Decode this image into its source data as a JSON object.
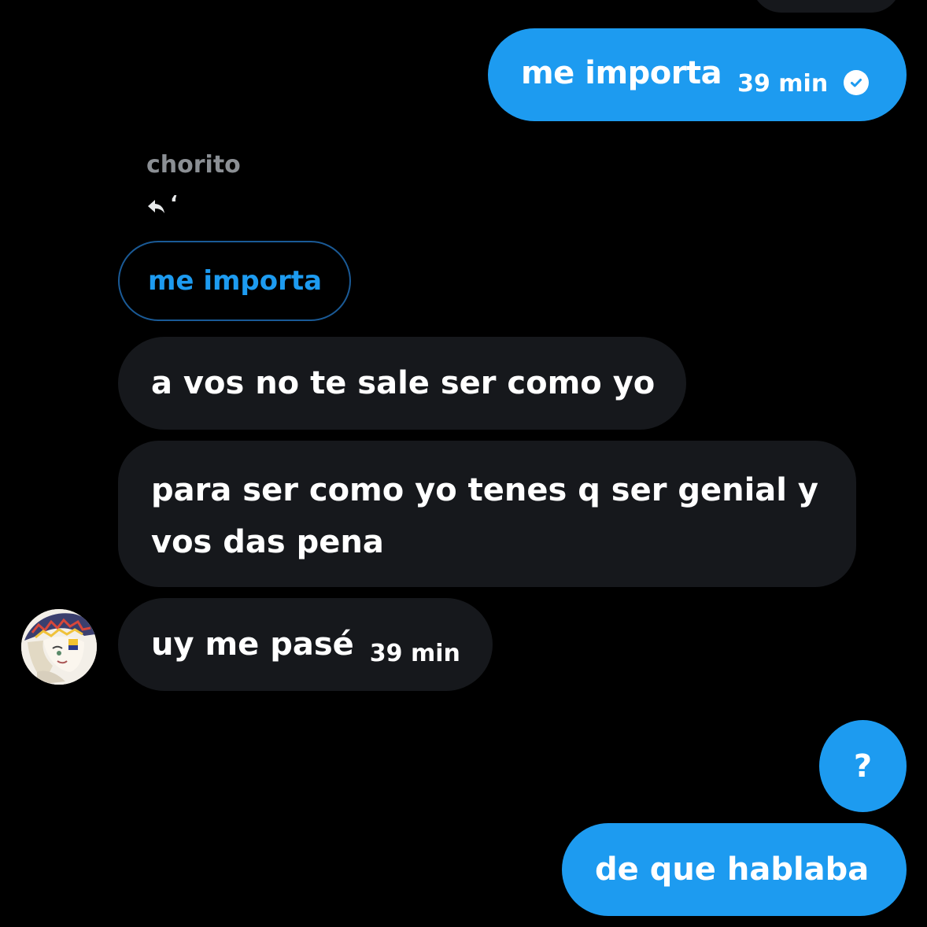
{
  "conversation": {
    "messages": [
      {
        "direction": "outgoing",
        "text": "me importa",
        "time": "39 min",
        "status": "check-circle-icon"
      },
      {
        "direction": "incoming",
        "sender": "chorito",
        "reply_to": "me importa",
        "text": "a vos no te sale ser como yo"
      },
      {
        "direction": "incoming",
        "text": "para ser como yo tenes q ser genial y vos das pena"
      },
      {
        "direction": "incoming",
        "text": "uy me pasé",
        "time": "39 min"
      },
      {
        "direction": "outgoing",
        "text": "?"
      },
      {
        "direction": "outgoing",
        "text": "de que hablaba"
      }
    ],
    "reply_quote_mark": "‘"
  },
  "colors": {
    "background": "#000000",
    "outgoing_bubble": "#1d9bf0",
    "incoming_bubble": "#16181c",
    "sender_name": "#8b8f94",
    "quoted_border": "#1a5a96",
    "quoted_text": "#1d9bf0"
  }
}
